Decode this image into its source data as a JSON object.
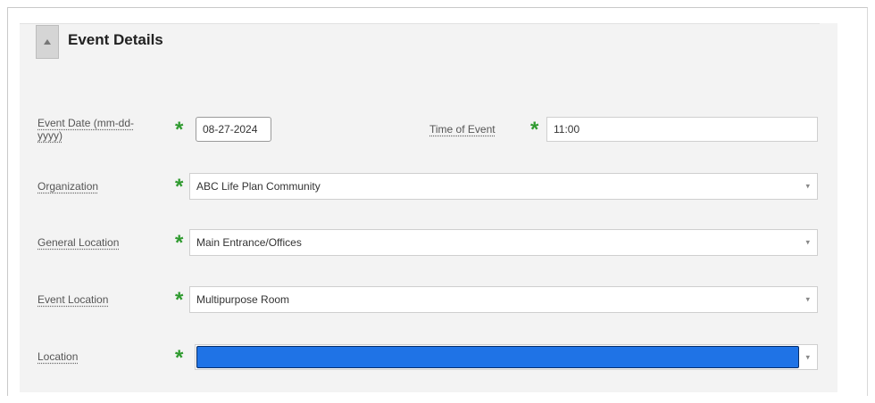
{
  "panel": {
    "title": "Event Details",
    "collapse_icon": "collapse-up-icon"
  },
  "fields": {
    "event_date": {
      "label": "Event Date (mm-dd-yyyy)",
      "value": "08-27-2024",
      "required": true
    },
    "time_of_event": {
      "label": "Time of Event",
      "value": "11:00",
      "required": true
    },
    "organization": {
      "label": "Organization",
      "value": "ABC Life Plan Community",
      "required": true
    },
    "general_location": {
      "label": "General Location",
      "value": "Main Entrance/Offices",
      "required": true
    },
    "event_location": {
      "label": "Event Location",
      "value": "Multipurpose Room",
      "required": true
    },
    "location": {
      "label": "Location",
      "value": "",
      "required": true
    }
  },
  "required_marker": "*",
  "dropdown_caret": "▾",
  "colors": {
    "required": "#2e9a2e",
    "selection_highlight": "#1f73e6",
    "panel_background": "#f3f3f3"
  }
}
